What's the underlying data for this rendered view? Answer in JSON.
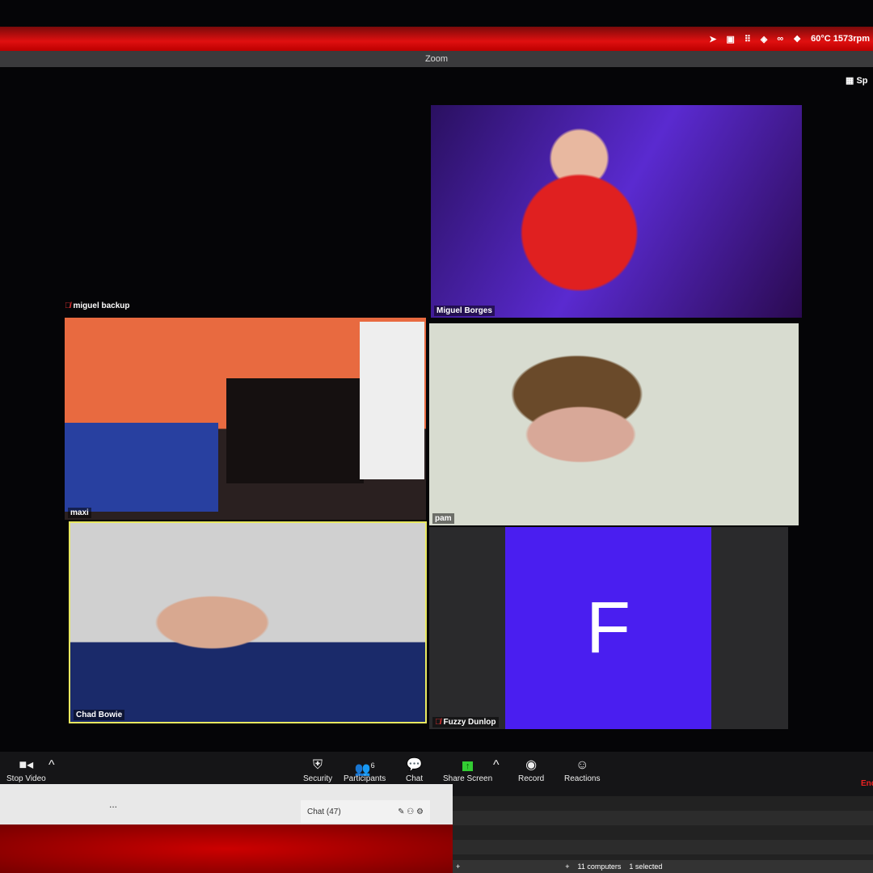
{
  "menubar": {
    "icons": [
      "location-icon",
      "zoom-icon",
      "grid-icon",
      "layers-icon",
      "binoculars-icon",
      "dropbox-icon"
    ],
    "status": "60°C 1573rpm"
  },
  "window": {
    "title": "Zoom",
    "view_label": "Sp"
  },
  "participants": [
    {
      "name": "Miguel Borges",
      "muted": false
    },
    {
      "name": "miguel backup",
      "muted": true
    },
    {
      "name": "maxi",
      "muted": false
    },
    {
      "name": "pam",
      "muted": false
    },
    {
      "name": "Chad Bowie",
      "muted": false,
      "active_speaker": true
    },
    {
      "name": "Fuzzy Dunlop",
      "muted": true,
      "avatar_letter": "F",
      "avatar_color": "#4a1ef0"
    }
  ],
  "toolbar": {
    "stop_video": "Stop Video",
    "security": "Security",
    "participants": "Participants",
    "participants_count": "6",
    "chat": "Chat",
    "share_screen": "Share Screen",
    "record": "Record",
    "reactions": "Reactions",
    "end": "End"
  },
  "chat": {
    "title": "Chat (47)",
    "more": "..."
  },
  "panel": {
    "status": "11 computers",
    "selected": "1 selected",
    "add": "+"
  }
}
